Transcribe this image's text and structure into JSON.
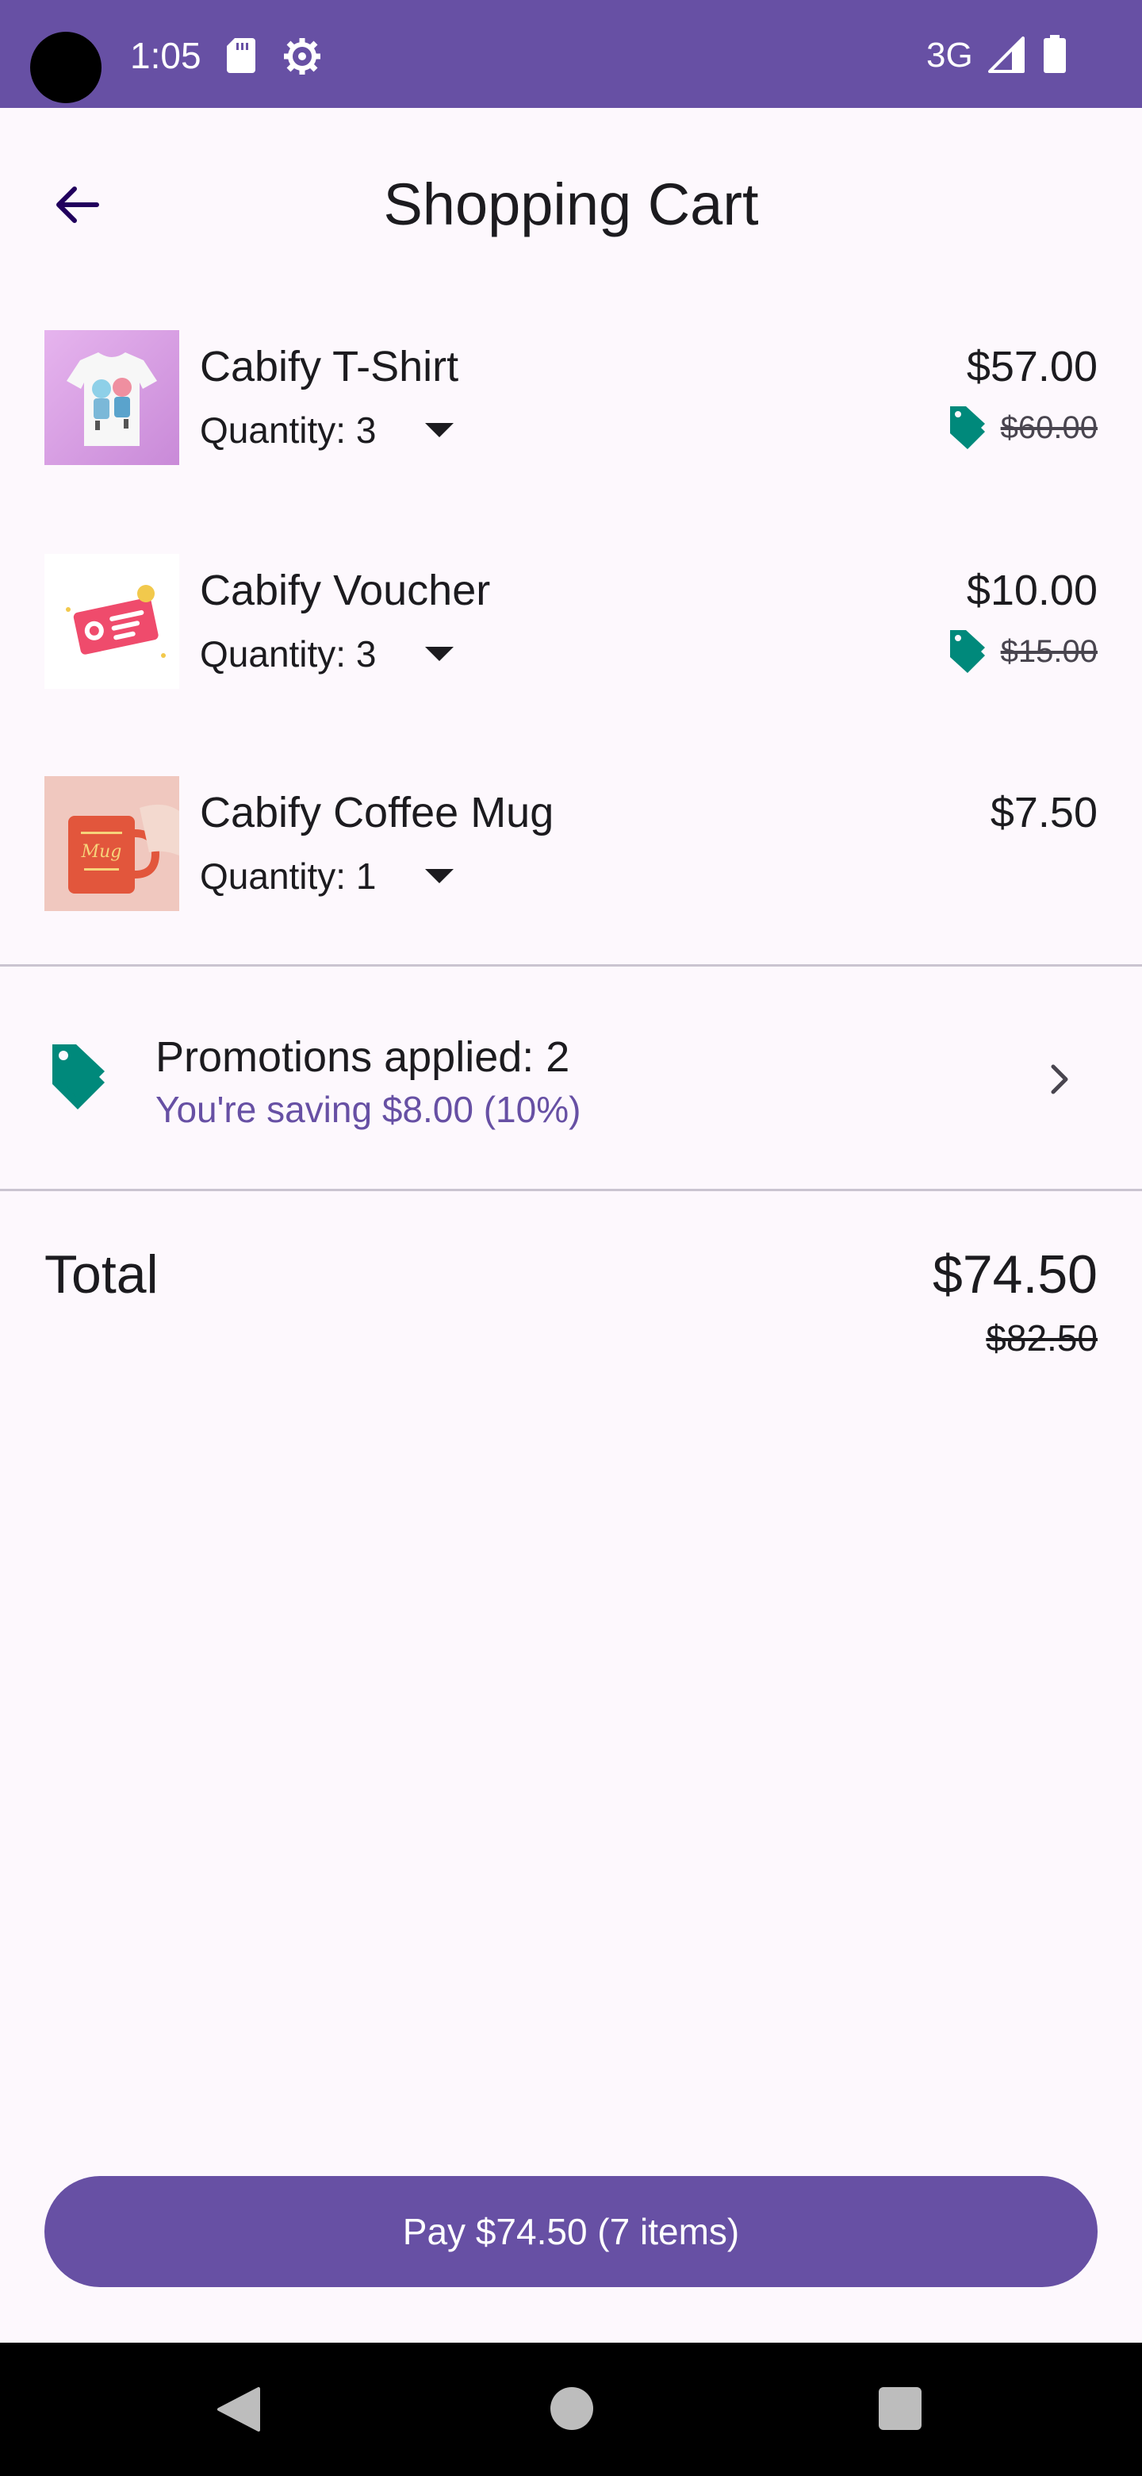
{
  "status_bar": {
    "time": "1:05",
    "network": "3G",
    "icons": [
      "sd-card-icon",
      "settings-icon",
      "signal-icon",
      "battery-icon"
    ]
  },
  "app_bar": {
    "title": "Shopping Cart",
    "back_icon": "arrow-back-icon"
  },
  "cart": {
    "items": [
      {
        "name": "Cabify T-Shirt",
        "quantity_label": "Quantity: 3",
        "price": "$57.00",
        "original_price": "$60.00",
        "discounted": true,
        "thumb_icon": "tshirt-image"
      },
      {
        "name": "Cabify Voucher",
        "quantity_label": "Quantity: 3",
        "price": "$10.00",
        "original_price": "$15.00",
        "discounted": true,
        "thumb_icon": "voucher-image"
      },
      {
        "name": "Cabify Coffee Mug",
        "quantity_label": "Quantity: 1",
        "price": "$7.50",
        "discounted": false,
        "thumb_icon": "mug-image"
      }
    ]
  },
  "promotions": {
    "title": "Promotions applied: 2",
    "subtitle": "You're saving $8.00 (10%)",
    "icon": "tag-icon"
  },
  "total": {
    "label": "Total",
    "value": "$74.50",
    "original_value": "$82.50"
  },
  "pay_button": {
    "label": "Pay $74.50 (7 items)"
  },
  "colors": {
    "primary": "#6750a4",
    "tag": "#00897b",
    "background": "#fdf8fd"
  }
}
